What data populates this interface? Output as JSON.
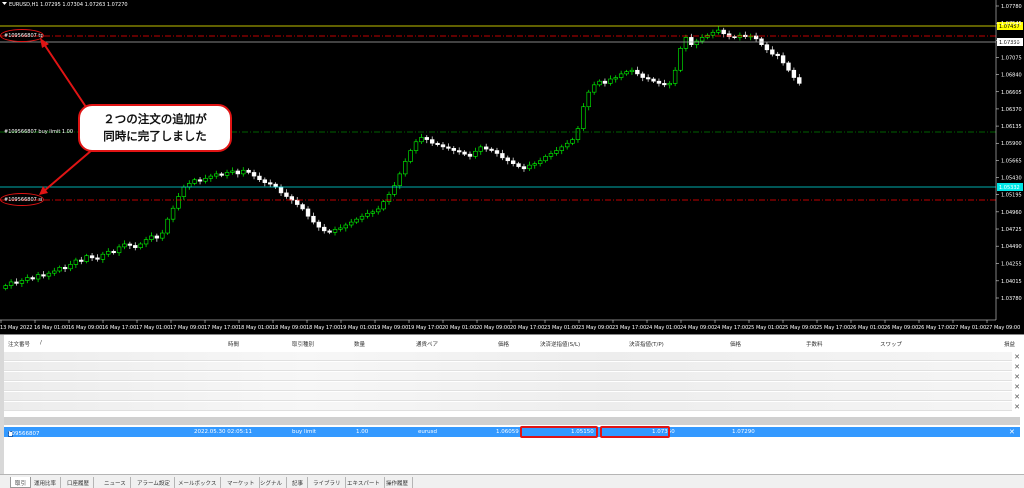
{
  "chart": {
    "title": "EURUSD,H1  1.07295 1.07304 1.07263 1.07270",
    "price_scale": [
      "1.07780",
      "1.07545",
      "1.07310",
      "1.07075",
      "1.06840",
      "1.06605",
      "1.06370",
      "1.06135",
      "1.05900",
      "1.05665",
      "1.05430",
      "1.05195",
      "1.04960",
      "1.04725",
      "1.04490",
      "1.04255",
      "1.04015",
      "1.03780"
    ],
    "time_labels": [
      "13 May 2022",
      "16 May 01:00",
      "16 May 09:00",
      "16 May 17:00",
      "17 May 01:00",
      "17 May 09:00",
      "17 May 17:00",
      "18 May 01:00",
      "18 May 09:00",
      "18 May 17:00",
      "19 May 01:00",
      "19 May 09:00",
      "19 May 17:00",
      "20 May 01:00",
      "20 May 09:00",
      "20 May 17:00",
      "23 May 01:00",
      "23 May 09:00",
      "23 May 17:00",
      "24 May 01:00",
      "24 May 09:00",
      "24 May 17:00",
      "25 May 01:00",
      "25 May 09:00",
      "25 May 17:00",
      "26 May 01:00",
      "26 May 09:00",
      "26 May 17:00",
      "27 May 01:00",
      "27 May 09:00"
    ],
    "order_lines": {
      "tp_label": "#109566807 tp",
      "buy_limit_label": "#109566807 buy limit 1.00",
      "sl_label": "#109566807 sl"
    },
    "price_tags": {
      "ask": "1.07457",
      "tp": "1.07350",
      "bid": "1.05332"
    },
    "callout_text": "２つの注文の追加が\n同時に完了しました",
    "colors": {
      "bull": "#00ff00",
      "bear": "#ffffff",
      "tp_line": "#ff0000",
      "sl_line": "#ff0000",
      "ask_line": "#ffff00",
      "bid_line": "#00e5e5",
      "limit_line": "#008000"
    }
  },
  "chart_data": {
    "type": "candlestick",
    "symbol": "EURUSD",
    "timeframe": "H1",
    "close": [
      1.0395,
      1.04,
      1.0398,
      1.0402,
      1.0406,
      1.0404,
      1.041,
      1.0408,
      1.0412,
      1.0415,
      1.042,
      1.0418,
      1.0424,
      1.043,
      1.0428,
      1.0436,
      1.0433,
      1.0431,
      1.0438,
      1.0442,
      1.044,
      1.0448,
      1.0452,
      1.045,
      1.0447,
      1.0452,
      1.0458,
      1.0463,
      1.046,
      1.0467,
      1.0486,
      1.0501,
      1.0517,
      1.053,
      1.0535,
      1.054,
      1.0538,
      1.0542,
      1.0545,
      1.0548,
      1.0546,
      1.055,
      1.0552,
      1.0548,
      1.0553,
      1.055,
      1.0545,
      1.054,
      1.0536,
      1.0534,
      1.053,
      1.0522,
      1.0517,
      1.0512,
      1.0506,
      1.05,
      1.049,
      1.0482,
      1.0475,
      1.047,
      1.0468,
      1.0472,
      1.0474,
      1.0478,
      1.0482,
      1.0486,
      1.049,
      1.0494,
      1.0496,
      1.05,
      1.051,
      1.052,
      1.0532,
      1.0548,
      1.0565,
      1.058,
      1.0592,
      1.0598,
      1.0595,
      1.059,
      1.0588,
      1.0585,
      1.0583,
      1.058,
      1.0578,
      1.0575,
      1.0572,
      1.0579,
      1.0585,
      1.0582,
      1.058,
      1.0576,
      1.057,
      1.0566,
      1.0562,
      1.0558,
      1.0555,
      1.056,
      1.0562,
      1.0566,
      1.0572,
      1.0576,
      1.058,
      1.0585,
      1.059,
      1.0595,
      1.061,
      1.064,
      1.066,
      1.067,
      1.0675,
      1.0672,
      1.0678,
      1.068,
      1.0685,
      1.0688,
      1.069,
      1.0685,
      1.068,
      1.0678,
      1.0675,
      1.0672,
      1.067,
      1.0672,
      1.069,
      1.072,
      1.0735,
      1.0725,
      1.073,
      1.0735,
      1.0738,
      1.0742,
      1.0745,
      1.074,
      1.0736,
      1.0735,
      1.0738,
      1.0736,
      1.0737,
      1.0733,
      1.0725,
      1.0718,
      1.0712,
      1.071,
      1.07,
      1.069,
      1.068,
      1.0672
    ]
  },
  "terminal": {
    "headers": [
      "注文番号",
      "/",
      "時間",
      "取引種別",
      "数量",
      "通貨ペア",
      "価格",
      "決済逆指値(S/L)",
      "決済指値(T/P)",
      "価格",
      "手数料",
      "スワップ",
      "損益"
    ],
    "selected_row": {
      "order_id": "109566807",
      "time": "2022.05.30 02:05:11",
      "type": "buy limit",
      "volume": "1.00",
      "symbol": "eurusd",
      "price": "1.06059",
      "sl": "1.05150",
      "tp": "1.07350",
      "current_price": "1.07290"
    },
    "close_symbol": "✕",
    "tabs": [
      "取引",
      "運用比率",
      "口座履歴",
      "ニュース",
      "アラーム設定",
      "メールボックス",
      "マーケット",
      "シグナル",
      "記事",
      "ライブラリ",
      "エキスパート",
      "操作履歴"
    ]
  }
}
